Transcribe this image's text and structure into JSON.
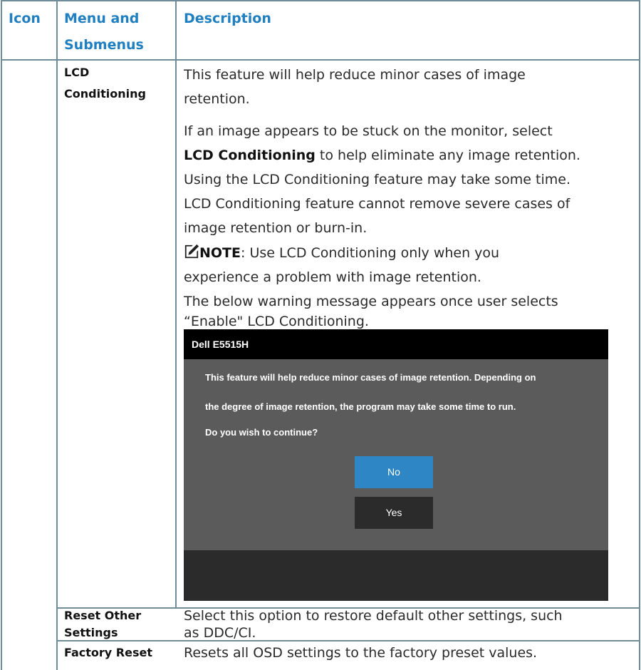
{
  "headers": {
    "icon": "Icon",
    "menu_line1": "Menu and",
    "menu_line2": "Submenus",
    "description": "Description"
  },
  "rows": [
    {
      "menu_line1": "LCD",
      "menu_line2": "Conditioning",
      "paragraph1_line1": "This feature will help reduce minor cases of image",
      "paragraph1_line2": "retention.",
      "paragraph2_line1": "If an image appears to be stuck on the monitor, select",
      "paragraph2_bold": "LCD Conditioning",
      "paragraph2_line2_rest": " to help eliminate any image retention.",
      "paragraph2_line3": "Using the LCD Conditioning feature may take some time.",
      "paragraph2_line4": "LCD Conditioning feature cannot remove  severe cases of",
      "paragraph2_line5": "image retention or burn-in.",
      "note_label": "NOTE",
      "note_line1_rest": ": Use LCD Conditioning only when you",
      "note_line2": "experience a problem with image retention.",
      "paragraph3_line1": "The below warning message appears once user selects",
      "paragraph3_line2": "“Enable\" LCD Conditioning.",
      "note_icon": "pencil-note-icon"
    },
    {
      "menu_line1": "Reset Other",
      "menu_line2": "Settings",
      "desc_line1": "Select this option to restore default other settings, such",
      "desc_line2": "as DDC/CI."
    },
    {
      "menu_line1": "Factory Reset",
      "desc_line1": "Resets all OSD settings to the factory preset values."
    }
  ],
  "osd_dialog": {
    "title": "Dell E5515H",
    "message_line1": "This feature will help reduce minor cases of image retention. Depending on",
    "message_line2": "the degree of image retention, the program may take some time to run.",
    "message_line3": "Do you wish to continue?",
    "no_label": "No",
    "yes_label": "Yes"
  },
  "colors": {
    "header_text": "#1f7fc0",
    "border": "#6f8d99",
    "osd_background": "#5b5b5b",
    "osd_title_bar": "#000000",
    "no_button": "#2e87c4",
    "yes_button": "#2b2b2b"
  }
}
